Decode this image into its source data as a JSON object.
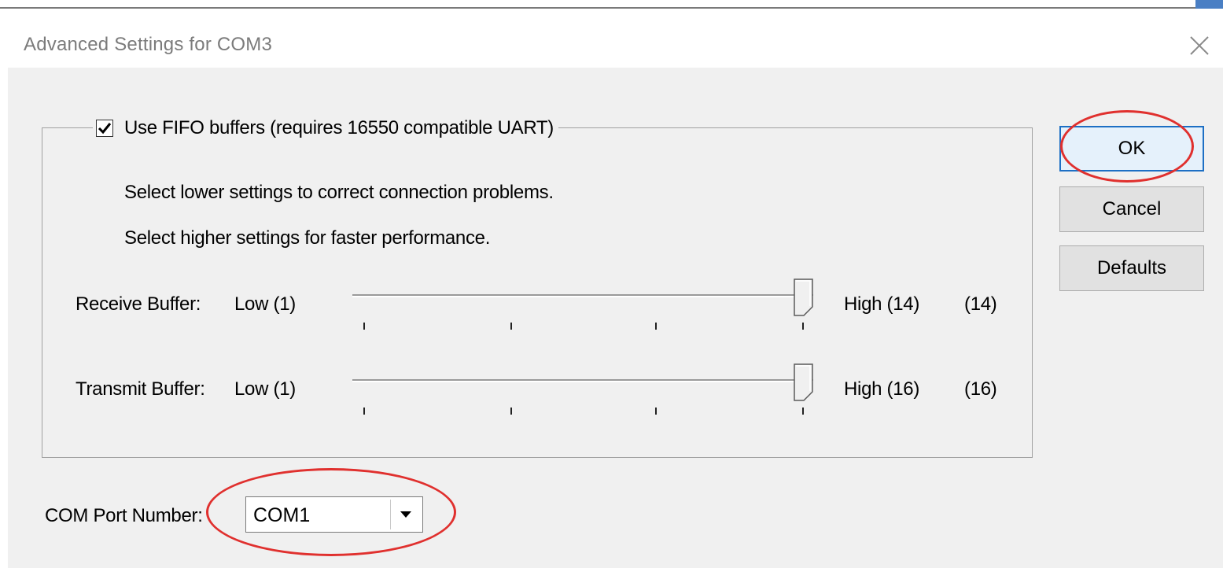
{
  "window": {
    "title": "Advanced Settings for COM3",
    "close_icon": "close-icon"
  },
  "fifo": {
    "checked": true,
    "label": "Use FIFO buffers (requires 16550 compatible UART)",
    "hint_lower": "Select lower settings to correct connection problems.",
    "hint_higher": "Select higher settings for faster performance."
  },
  "receive": {
    "label": "Receive Buffer:",
    "low_label": "Low (1)",
    "high_label": "High (14)",
    "value_label": "(14)",
    "level_fraction": 1.0
  },
  "transmit": {
    "label": "Transmit Buffer:",
    "low_label": "Low (1)",
    "high_label": "High (16)",
    "value_label": "(16)",
    "level_fraction": 1.0
  },
  "buttons": {
    "ok": "OK",
    "cancel": "Cancel",
    "defaults": "Defaults"
  },
  "com_port": {
    "label": "COM Port Number:",
    "selected": "COM1"
  },
  "colors": {
    "annotation": "#e0302e",
    "focus_border": "#1d6fc4"
  }
}
